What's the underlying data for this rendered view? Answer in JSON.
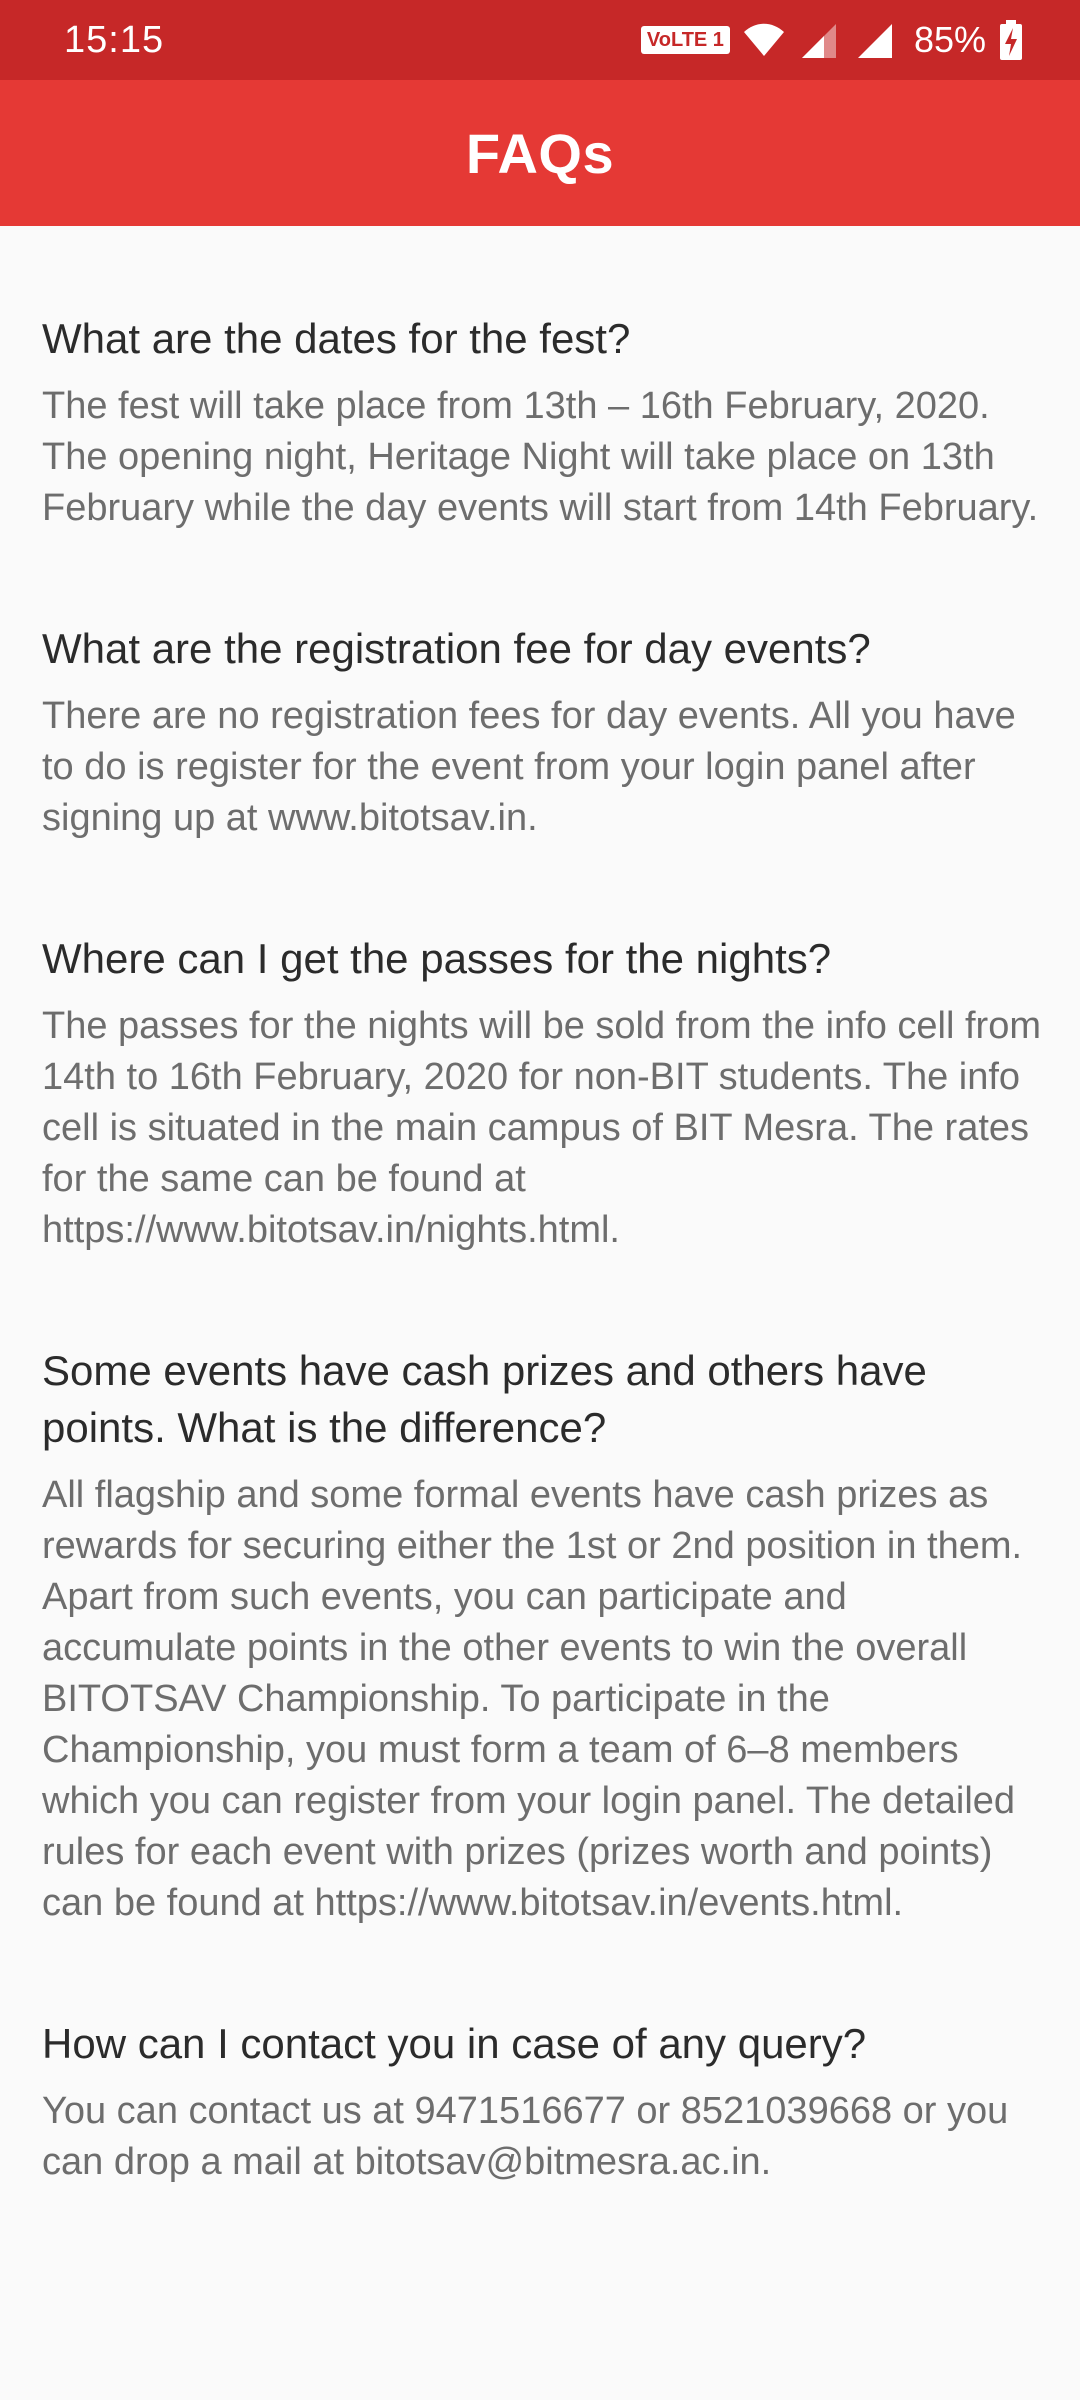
{
  "status_bar": {
    "time": "15:15",
    "network_badge": "VoLTE 1",
    "battery": "85%",
    "icons": [
      "wifi-icon",
      "signal-icon",
      "signal-icon",
      "battery-charging-icon"
    ]
  },
  "app_bar": {
    "title": "FAQs",
    "colors": {
      "status_bar": "#c62828",
      "app_bar": "#e53935"
    }
  },
  "faqs": [
    {
      "question": "What are the dates for the fest?",
      "answer": "The fest will take place from 13th – 16th February, 2020. The opening night, Heritage Night will take place on 13th February while the day events will start from 14th February."
    },
    {
      "question": "What are the registration fee for day events?",
      "answer": "There are no registration fees for day events. All you have to do is register for the event from your login panel after signing up at www.bitotsav.in."
    },
    {
      "question": "Where can I get the passes for the nights?",
      "answer": "The passes for the nights will be sold from the info cell from 14th to 16th February, 2020 for non-BIT students. The info cell is situated in the main campus of BIT Mesra. The rates for the same can be found at https://www.bitotsav.in/nights.html."
    },
    {
      "question": "Some events have cash prizes and others have points. What is the difference?",
      "answer": "All flagship and some formal events have cash prizes as rewards for securing either the 1st or 2nd position in them. Apart from such events, you can participate and accumulate points in the other events to win the overall BITOTSAV Championship. To participate in the Championship, you must form a team of 6–8 members which you can register from your login panel. The detailed rules for each event with prizes (prizes worth and points) can be found at https://www.bitotsav.in/events.html."
    },
    {
      "question": "How can I contact you in case of any query?",
      "answer": "You can contact us at 9471516677 or 8521039668 or you can drop a mail at bitotsav@bitmesra.ac.in."
    }
  ]
}
